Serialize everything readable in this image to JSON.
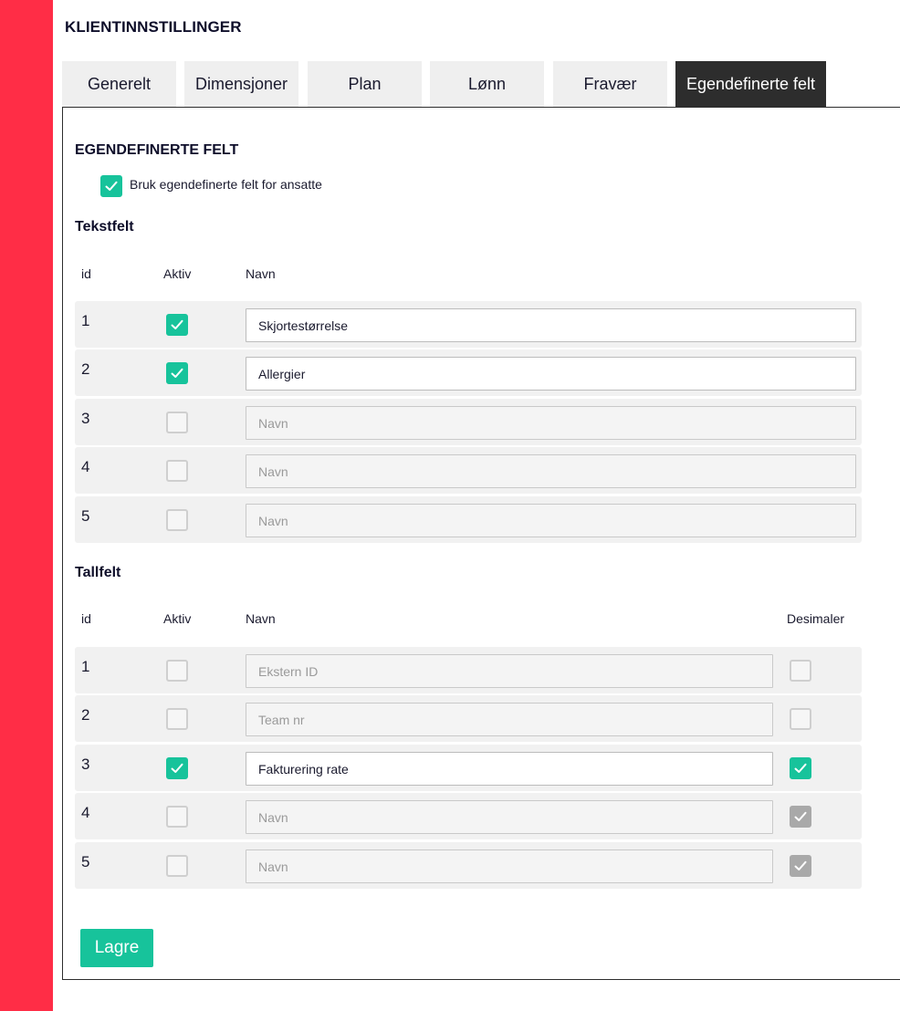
{
  "page_title": "KLIENTINNSTILLINGER",
  "tabs": [
    {
      "label": "Generelt",
      "active": false
    },
    {
      "label": "Dimensjoner",
      "active": false
    },
    {
      "label": "Plan",
      "active": false
    },
    {
      "label": "Lønn",
      "active": false
    },
    {
      "label": "Fravær",
      "active": false
    },
    {
      "label": "Egendefinerte felt",
      "active": true
    }
  ],
  "section_title": "EGENDEFINERTE FELT",
  "use_custom_fields": {
    "label": "Bruk egendefinerte felt for ansatte",
    "checked": true
  },
  "text_fields": {
    "title": "Tekstfelt",
    "headers": {
      "id": "id",
      "active": "Aktiv",
      "name": "Navn"
    },
    "rows": [
      {
        "id": "1",
        "active": true,
        "value": "Skjortestørrelse",
        "placeholder": "Navn"
      },
      {
        "id": "2",
        "active": true,
        "value": "Allergier",
        "placeholder": "Navn"
      },
      {
        "id": "3",
        "active": false,
        "value": "",
        "placeholder": "Navn"
      },
      {
        "id": "4",
        "active": false,
        "value": "",
        "placeholder": "Navn"
      },
      {
        "id": "5",
        "active": false,
        "value": "",
        "placeholder": "Navn"
      }
    ]
  },
  "number_fields": {
    "title": "Tallfelt",
    "headers": {
      "id": "id",
      "active": "Aktiv",
      "name": "Navn",
      "decimals": "Desimaler"
    },
    "rows": [
      {
        "id": "1",
        "active": false,
        "value": "",
        "placeholder": "Ekstern ID",
        "decimals": "unchecked"
      },
      {
        "id": "2",
        "active": false,
        "value": "",
        "placeholder": "Team nr",
        "decimals": "unchecked"
      },
      {
        "id": "3",
        "active": true,
        "value": "Fakturering rate",
        "placeholder": "Navn",
        "decimals": "checked"
      },
      {
        "id": "4",
        "active": false,
        "value": "",
        "placeholder": "Navn",
        "decimals": "checked-disabled"
      },
      {
        "id": "5",
        "active": false,
        "value": "",
        "placeholder": "Navn",
        "decimals": "checked-disabled"
      }
    ]
  },
  "save_label": "Lagre",
  "colors": {
    "brand_red": "#ff2d46",
    "accent_green": "#17c39b",
    "active_tab": "#2d2d2d",
    "disabled_check": "#a9a9a9"
  }
}
